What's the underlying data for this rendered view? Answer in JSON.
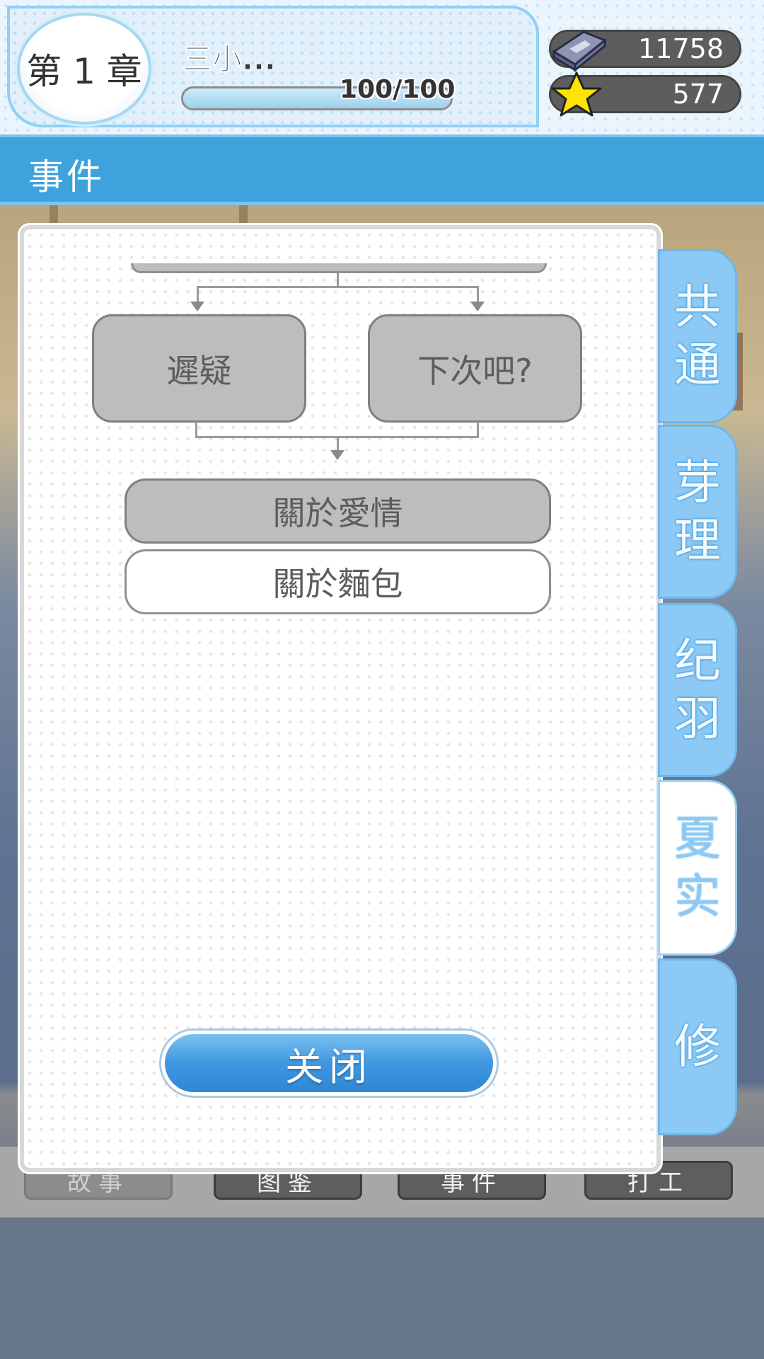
{
  "header": {
    "chapter": "第 1 章",
    "story_title": "三小...",
    "progress_text": "100/100",
    "progress_fraction": 1.0,
    "currencies": [
      {
        "icon": "book-gem-icon",
        "value": "11758"
      },
      {
        "icon": "star-icon",
        "value": "577"
      }
    ]
  },
  "section": {
    "title": "事件"
  },
  "flow": {
    "choices": [
      "遲疑",
      "下次吧?"
    ],
    "events": [
      "關於愛情",
      "關於麵包"
    ]
  },
  "modal": {
    "close_label": "关闭"
  },
  "tabs": [
    "共通",
    "芽理",
    "纪羽",
    "夏实",
    "修"
  ],
  "active_tab": "夏实",
  "bottom_nav": [
    "故事",
    "图鉴",
    "事件",
    "打工"
  ],
  "colors": {
    "accent": "#3ea3dc",
    "tab": "#8ccaf5",
    "node_grey": "#bdbdbd"
  }
}
